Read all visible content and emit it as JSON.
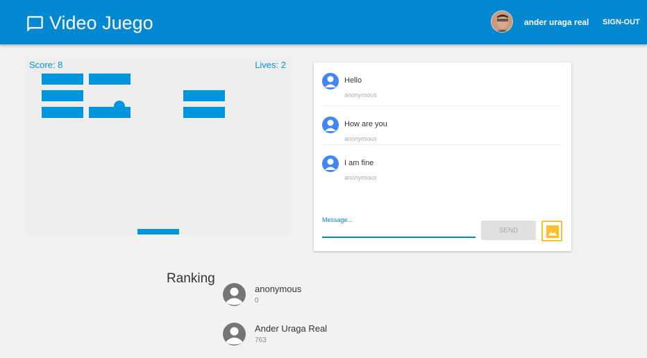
{
  "header": {
    "title": "Video Juego",
    "logo_icon": "chat-bubble-icon",
    "user_name": "ander uraga real",
    "signout_label": "SIGN-OUT",
    "background_color": "#0288d1"
  },
  "game": {
    "score_text": "Score: 8",
    "lives_text": "Lives: 2",
    "color": "#0095dd"
  },
  "chat": {
    "messages": [
      {
        "text": "Hello",
        "author": "anonymous"
      },
      {
        "text": "How are you",
        "author": "anonymous"
      },
      {
        "text": "I am fine",
        "author": "anonymous"
      }
    ],
    "message_placeholder": "Message...",
    "send_label": "SEND",
    "image_button_icon": "image-icon"
  },
  "ranking": {
    "title": "Ranking",
    "entries": [
      {
        "name": "anonymous",
        "score": "0"
      },
      {
        "name": "Ander Uraga Real",
        "score": "763"
      }
    ]
  }
}
